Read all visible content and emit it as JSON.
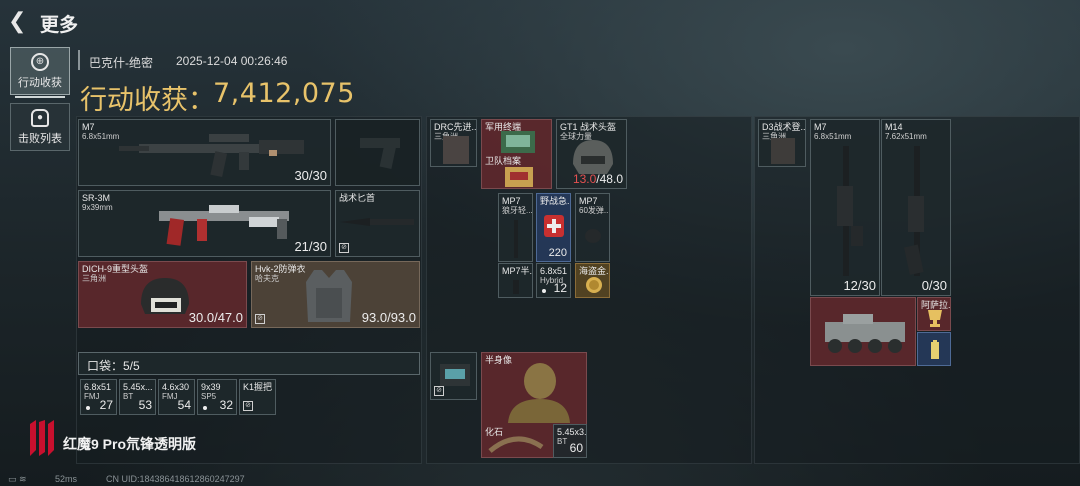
{
  "header": {
    "title": "更多"
  },
  "sidebar": {
    "tabs": [
      {
        "label": "行动收获",
        "active": true
      },
      {
        "label": "击败列表",
        "active": false
      }
    ]
  },
  "info": {
    "map": "巴克什-绝密",
    "datetime": "2025-12-04 00:26:46",
    "haul_label": "行动收获：",
    "haul_value": "7,412,075"
  },
  "loadout": {
    "m7": {
      "name": "M7",
      "ammo": "6.8x51mm",
      "count": "30/30"
    },
    "sr3m": {
      "name": "SR-3M",
      "ammo": "9x39mm",
      "count": "21/30"
    },
    "knife": {
      "name": "战术匕首"
    },
    "helmet": {
      "name": "DICH-9重型头盔",
      "sub": "三角洲",
      "count": "30.0/47.0"
    },
    "armor": {
      "name": "Hvk-2防弹衣",
      "sub": "哈夫克",
      "count": "93.0/93.0"
    }
  },
  "pocket": {
    "label": "口袋：5/5",
    "items": [
      {
        "name": "6.8x51",
        "sub": "FMJ",
        "count": "27"
      },
      {
        "name": "5.45x...",
        "sub": "BT",
        "count": "53"
      },
      {
        "name": "4.6x30",
        "sub": "FMJ",
        "count": "54"
      },
      {
        "name": "9x39",
        "sub": "SP5",
        "count": "32"
      },
      {
        "name": "K1握把",
        "sub": "",
        "count": ""
      }
    ]
  },
  "middle": {
    "drc": {
      "name": "DRC先进...",
      "sub": "三角洲"
    },
    "military": {
      "name": "军用终端",
      "sub": ""
    },
    "guard": {
      "name": "卫队档案",
      "sub": ""
    },
    "gt1": {
      "name": "GT1 战术头盔",
      "sub": "全球力量",
      "count_red": "13.0",
      "count_rest": "/48.0"
    },
    "mp7a": {
      "name": "MP7",
      "sub": "狼牙轻..."
    },
    "firstaid": {
      "name": "野战急...",
      "count": "220"
    },
    "mp7b": {
      "name": "MP7",
      "sub": "60发弹..."
    },
    "mp7c": {
      "name": "MP7半..."
    },
    "ammo68": {
      "name": "6.8x51",
      "sub": "Hybrid",
      "count": "12"
    },
    "seacoin": {
      "name": "海盗金..."
    },
    "case": {
      "name": ""
    },
    "bust": {
      "name": "半身像"
    },
    "fossil": {
      "name": "化石"
    },
    "ammo545": {
      "name": "5.45x3...",
      "sub": "BT",
      "count": "60"
    }
  },
  "right": {
    "d3": {
      "name": "D3战术登...",
      "sub": "三角洲"
    },
    "m7": {
      "name": "M7",
      "ammo": "6.8x51mm",
      "count": "12/30"
    },
    "m14": {
      "name": "M14",
      "ammo": "7.62x51mm",
      "count": "0/30"
    },
    "apc": {
      "name": ""
    },
    "trophy": {
      "name": "阿萨拉..."
    },
    "battery": {
      "name": ""
    }
  },
  "brand": {
    "text": "红魔9 Pro氘锋透明版"
  },
  "status": {
    "ping": "52ms",
    "uid": "CN UID:18438641861286024729​7"
  },
  "colors": {
    "accent": "#e8c36a",
    "red_value": "#e45050"
  }
}
